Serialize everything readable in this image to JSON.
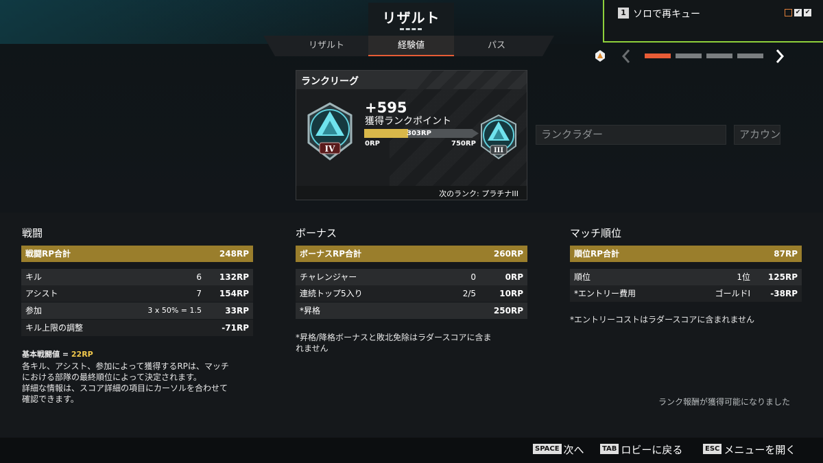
{
  "header": {
    "main_tab": "リザルト",
    "sub_tabs": [
      "リザルト",
      "経験値",
      "パス"
    ],
    "active_sub_tab": "経験値"
  },
  "queue": {
    "number": "1",
    "label": "ソロで再キュー"
  },
  "pager": {
    "total_pages": 5,
    "current_page": 1
  },
  "rank_card": {
    "title": "ランクリーグ",
    "rp_gain": "+595",
    "rp_label": "獲得ランクポイント",
    "progress_current": "303RP",
    "progress_min": "0RP",
    "progress_max": "750RP",
    "progress_fraction": 0.404,
    "current_tier": "IV",
    "next_tier": "III",
    "next_rank_text": "次のランク: プラチナIII"
  },
  "side_panels": {
    "ladder": "ランクラダー",
    "account": "アカウント"
  },
  "combat": {
    "title": "戦闘",
    "total": {
      "label": "戦闘RP合計",
      "value": "248RP"
    },
    "rows": [
      {
        "label": "キル",
        "count": "6",
        "value": "132RP"
      },
      {
        "label": "アシスト",
        "count": "7",
        "value": "154RP"
      },
      {
        "label": "参加",
        "count": "3 x 50% = 1.5",
        "value": "33RP"
      },
      {
        "label": "キル上限の調整",
        "count": "",
        "value": "-71RP"
      }
    ],
    "base_label": "基本戦闘値 =",
    "base_value": "22RP",
    "desc_lines": [
      "各キル、アシスト、参加によって獲得するRPは、マッチ",
      "における部隊の最終順位によって決定されます。",
      "詳細な情報は、スコア詳細の項目にカーソルを合わせて",
      "確認できます。"
    ]
  },
  "bonus": {
    "title": "ボーナス",
    "total": {
      "label": "ボーナスRP合計",
      "value": "260RP"
    },
    "rows": [
      {
        "label": "チャレンジャー",
        "count": "0",
        "value": "0RP"
      },
      {
        "label": "連続トップ5入り",
        "count": "2/5",
        "value": "10RP"
      },
      {
        "label": "*昇格",
        "count": "",
        "value": "250RP"
      }
    ],
    "note_lines": [
      "*昇格/降格ボーナスと敗北免除はラダースコアに含ま",
      "れません"
    ]
  },
  "placement": {
    "title": "マッチ順位",
    "total": {
      "label": "順位RP合計",
      "value": "87RP"
    },
    "rows": [
      {
        "label": "順位",
        "count": "1位",
        "value": "125RP"
      },
      {
        "label": "*エントリー費用",
        "count": "ゴールドI",
        "value": "-38RP"
      }
    ],
    "note": "*エントリーコストはラダースコアに含まれません",
    "reward_text": "ランク報酬が獲得可能になりました"
  },
  "footer": [
    {
      "key": "SPACE",
      "label": "次へ"
    },
    {
      "key": "TAB",
      "label": "ロビーに戻る"
    },
    {
      "key": "ESC",
      "label": "メニューを開く"
    }
  ],
  "colors": {
    "accent_green": "#8fd13b",
    "gold": "#9a7e2c",
    "progress_yellow": "#d9b84a",
    "active_orange": "#e85c36"
  }
}
